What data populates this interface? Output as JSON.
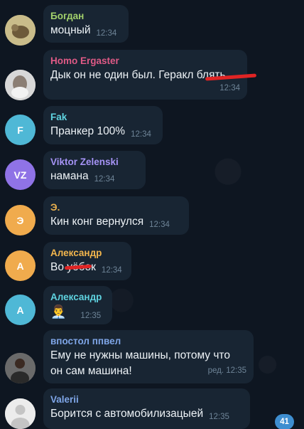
{
  "messages": [
    {
      "sender": "Богдан",
      "sender_color": "#a3d26c",
      "text": "моцный",
      "time": "12:34",
      "avatar": {
        "type": "photo",
        "color": "#b7a66e"
      }
    },
    {
      "sender": "Homo Ergaster",
      "sender_color": "#e05a86",
      "text": "Дык он не один был. Геракл блять",
      "time": "12:34",
      "avatar": {
        "type": "photo",
        "color": "#cfcfcf"
      }
    },
    {
      "sender": "Fak",
      "sender_color": "#5fd3e0",
      "text": "Пранкер 100%",
      "time": "12:34",
      "avatar": {
        "type": "initials",
        "initials": "F",
        "color": "#4fb8d6"
      }
    },
    {
      "sender": "Viktor Zelenski",
      "sender_color": "#a593f5",
      "text": "намана",
      "time": "12:34",
      "avatar": {
        "type": "initials",
        "initials": "VZ",
        "color": "#8f73e6"
      }
    },
    {
      "sender": "Э.",
      "sender_color": "#e8b04e",
      "text": "Кин конг  вернулся",
      "time": "12:34",
      "avatar": {
        "type": "initials",
        "initials": "Э",
        "color": "#f0ab4d"
      }
    },
    {
      "sender": "Александр",
      "sender_color": "#f3b64d",
      "text": "Во уёбок",
      "time": "12:34",
      "avatar": {
        "type": "initials",
        "initials": "А",
        "color": "#f0ab4d"
      }
    },
    {
      "sender": "Александр",
      "sender_color": "#5fd3e0",
      "text": "👨‍💼",
      "time": "12:35",
      "avatar": {
        "type": "initials",
        "initials": "А",
        "color": "#4fb8d6"
      }
    },
    {
      "sender": "впостол ппвел",
      "sender_color": "#7fa6e8",
      "text": "Ему не нужны машины, потому что",
      "text2": "он сам машина!",
      "time": "ред. 12:35",
      "avatar": {
        "type": "photo",
        "color": "#5a5a5a"
      }
    },
    {
      "sender": "Valerii",
      "sender_color": "#7fa6e8",
      "text": "Борится с автомобилизацыей",
      "time": "12:35",
      "avatar": {
        "type": "photo",
        "color": "#e5e5e5"
      }
    }
  ],
  "unread_badge": "41"
}
